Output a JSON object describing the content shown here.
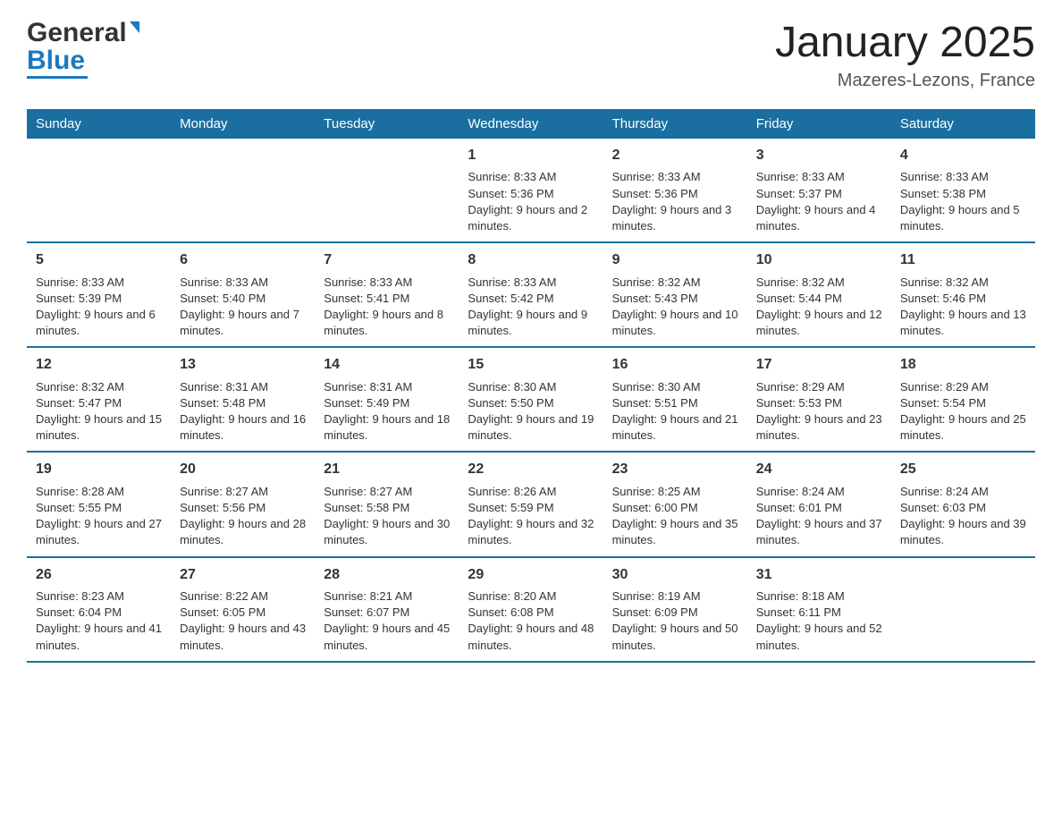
{
  "header": {
    "logo_line1": "General",
    "logo_line2": "Blue",
    "title": "January 2025",
    "subtitle": "Mazeres-Lezons, France"
  },
  "columns": [
    "Sunday",
    "Monday",
    "Tuesday",
    "Wednesday",
    "Thursday",
    "Friday",
    "Saturday"
  ],
  "weeks": [
    [
      {
        "day": "",
        "info": ""
      },
      {
        "day": "",
        "info": ""
      },
      {
        "day": "",
        "info": ""
      },
      {
        "day": "1",
        "info": "Sunrise: 8:33 AM\nSunset: 5:36 PM\nDaylight: 9 hours and 2 minutes."
      },
      {
        "day": "2",
        "info": "Sunrise: 8:33 AM\nSunset: 5:36 PM\nDaylight: 9 hours and 3 minutes."
      },
      {
        "day": "3",
        "info": "Sunrise: 8:33 AM\nSunset: 5:37 PM\nDaylight: 9 hours and 4 minutes."
      },
      {
        "day": "4",
        "info": "Sunrise: 8:33 AM\nSunset: 5:38 PM\nDaylight: 9 hours and 5 minutes."
      }
    ],
    [
      {
        "day": "5",
        "info": "Sunrise: 8:33 AM\nSunset: 5:39 PM\nDaylight: 9 hours and 6 minutes."
      },
      {
        "day": "6",
        "info": "Sunrise: 8:33 AM\nSunset: 5:40 PM\nDaylight: 9 hours and 7 minutes."
      },
      {
        "day": "7",
        "info": "Sunrise: 8:33 AM\nSunset: 5:41 PM\nDaylight: 9 hours and 8 minutes."
      },
      {
        "day": "8",
        "info": "Sunrise: 8:33 AM\nSunset: 5:42 PM\nDaylight: 9 hours and 9 minutes."
      },
      {
        "day": "9",
        "info": "Sunrise: 8:32 AM\nSunset: 5:43 PM\nDaylight: 9 hours and 10 minutes."
      },
      {
        "day": "10",
        "info": "Sunrise: 8:32 AM\nSunset: 5:44 PM\nDaylight: 9 hours and 12 minutes."
      },
      {
        "day": "11",
        "info": "Sunrise: 8:32 AM\nSunset: 5:46 PM\nDaylight: 9 hours and 13 minutes."
      }
    ],
    [
      {
        "day": "12",
        "info": "Sunrise: 8:32 AM\nSunset: 5:47 PM\nDaylight: 9 hours and 15 minutes."
      },
      {
        "day": "13",
        "info": "Sunrise: 8:31 AM\nSunset: 5:48 PM\nDaylight: 9 hours and 16 minutes."
      },
      {
        "day": "14",
        "info": "Sunrise: 8:31 AM\nSunset: 5:49 PM\nDaylight: 9 hours and 18 minutes."
      },
      {
        "day": "15",
        "info": "Sunrise: 8:30 AM\nSunset: 5:50 PM\nDaylight: 9 hours and 19 minutes."
      },
      {
        "day": "16",
        "info": "Sunrise: 8:30 AM\nSunset: 5:51 PM\nDaylight: 9 hours and 21 minutes."
      },
      {
        "day": "17",
        "info": "Sunrise: 8:29 AM\nSunset: 5:53 PM\nDaylight: 9 hours and 23 minutes."
      },
      {
        "day": "18",
        "info": "Sunrise: 8:29 AM\nSunset: 5:54 PM\nDaylight: 9 hours and 25 minutes."
      }
    ],
    [
      {
        "day": "19",
        "info": "Sunrise: 8:28 AM\nSunset: 5:55 PM\nDaylight: 9 hours and 27 minutes."
      },
      {
        "day": "20",
        "info": "Sunrise: 8:27 AM\nSunset: 5:56 PM\nDaylight: 9 hours and 28 minutes."
      },
      {
        "day": "21",
        "info": "Sunrise: 8:27 AM\nSunset: 5:58 PM\nDaylight: 9 hours and 30 minutes."
      },
      {
        "day": "22",
        "info": "Sunrise: 8:26 AM\nSunset: 5:59 PM\nDaylight: 9 hours and 32 minutes."
      },
      {
        "day": "23",
        "info": "Sunrise: 8:25 AM\nSunset: 6:00 PM\nDaylight: 9 hours and 35 minutes."
      },
      {
        "day": "24",
        "info": "Sunrise: 8:24 AM\nSunset: 6:01 PM\nDaylight: 9 hours and 37 minutes."
      },
      {
        "day": "25",
        "info": "Sunrise: 8:24 AM\nSunset: 6:03 PM\nDaylight: 9 hours and 39 minutes."
      }
    ],
    [
      {
        "day": "26",
        "info": "Sunrise: 8:23 AM\nSunset: 6:04 PM\nDaylight: 9 hours and 41 minutes."
      },
      {
        "day": "27",
        "info": "Sunrise: 8:22 AM\nSunset: 6:05 PM\nDaylight: 9 hours and 43 minutes."
      },
      {
        "day": "28",
        "info": "Sunrise: 8:21 AM\nSunset: 6:07 PM\nDaylight: 9 hours and 45 minutes."
      },
      {
        "day": "29",
        "info": "Sunrise: 8:20 AM\nSunset: 6:08 PM\nDaylight: 9 hours and 48 minutes."
      },
      {
        "day": "30",
        "info": "Sunrise: 8:19 AM\nSunset: 6:09 PM\nDaylight: 9 hours and 50 minutes."
      },
      {
        "day": "31",
        "info": "Sunrise: 8:18 AM\nSunset: 6:11 PM\nDaylight: 9 hours and 52 minutes."
      },
      {
        "day": "",
        "info": ""
      }
    ]
  ]
}
